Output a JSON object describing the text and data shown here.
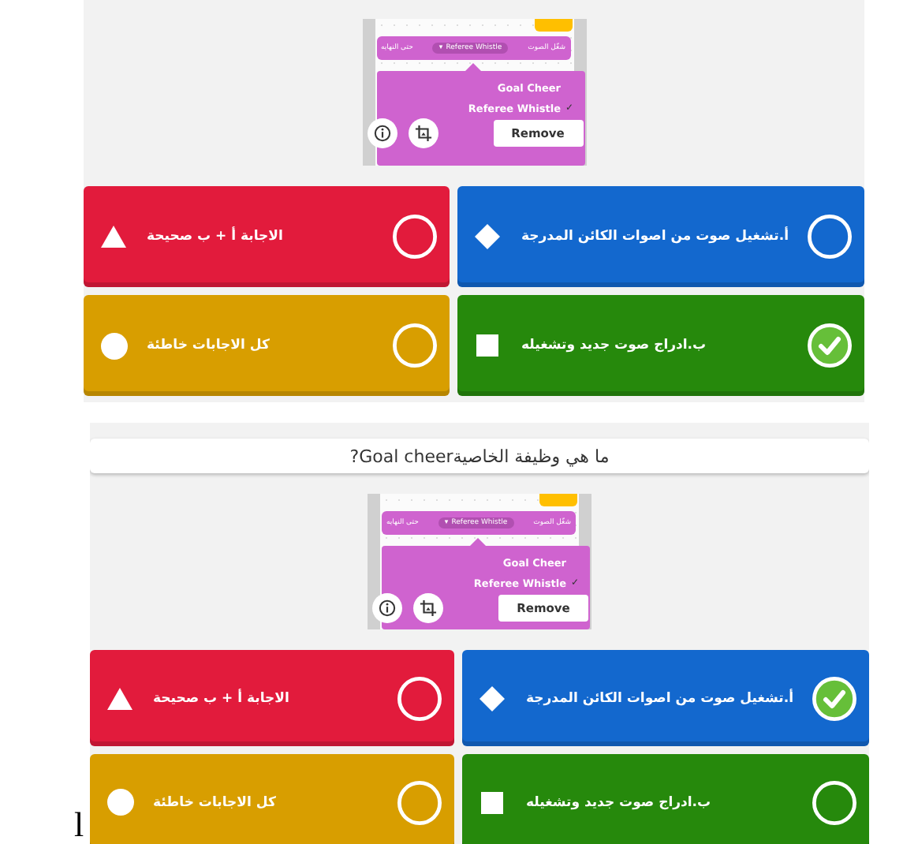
{
  "panels": [
    {
      "snapshot": {
        "block_label": "شغّل الصوت",
        "dropdown_arrow": "▾",
        "dropdown_value": "Referee Whistle",
        "block_suffix": "حتى النهايه",
        "check_mark": "✓",
        "menu_items": [
          {
            "label": "Goal Cheer",
            "selected": false
          },
          {
            "label": "Referee Whistle",
            "selected": true
          }
        ],
        "remove_button": "Remove"
      },
      "answers": [
        {
          "kind": "diamond",
          "text": "أ.تشغيل صوت من اصوات الكائن المدرجة",
          "color": "#1368ce",
          "selected": false
        },
        {
          "kind": "triangle",
          "text": "الاجابة أ + ب صحيحة",
          "color": "#e21b3c",
          "selected": false
        },
        {
          "kind": "square",
          "text": "ب.ادراج صوت جديد وتشغيله",
          "color": "#26890c",
          "selected": true
        },
        {
          "kind": "circle",
          "text": "كل الاجابات خاطئة",
          "color": "#d89e00",
          "selected": false
        }
      ]
    },
    {
      "question": "ما هي وظيفة الخاصيةGoal cheer?",
      "snapshot": {
        "block_label": "شغّل الصوت",
        "dropdown_arrow": "▾",
        "dropdown_value": "Referee Whistle",
        "block_suffix": "حتى النهايه",
        "check_mark": "✓",
        "menu_items": [
          {
            "label": "Goal Cheer",
            "selected": false
          },
          {
            "label": "Referee Whistle",
            "selected": true
          }
        ],
        "remove_button": "Remove"
      },
      "answers": [
        {
          "kind": "diamond",
          "text": "أ.تشغيل صوت من اصوات الكائن المدرجة",
          "color": "#1368ce",
          "selected": true
        },
        {
          "kind": "triangle",
          "text": "الاجابة أ + ب صحيحة",
          "color": "#e21b3c",
          "selected": false
        },
        {
          "kind": "square",
          "text": "ب.ادراج صوت جديد وتشغيله",
          "color": "#26890c",
          "selected": false
        },
        {
          "kind": "circle",
          "text": "كل الاجابات خاطئة",
          "color": "#d89e00",
          "selected": false
        }
      ]
    }
  ],
  "stray_mark": "l"
}
